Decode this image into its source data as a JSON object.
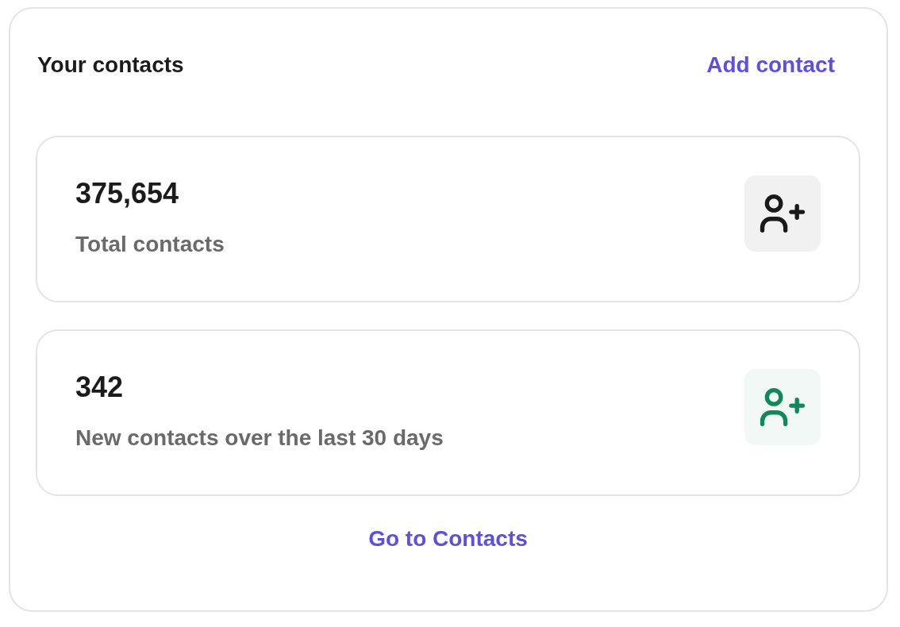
{
  "header": {
    "title": "Your contacts",
    "action": "Add contact"
  },
  "stats": [
    {
      "value": "375,654",
      "label": "Total contacts",
      "color": "#1a1a1a"
    },
    {
      "value": "342",
      "label": "New contacts over the last 30 days",
      "color": "#10875c"
    }
  ],
  "footer_link": "Go to Contacts"
}
